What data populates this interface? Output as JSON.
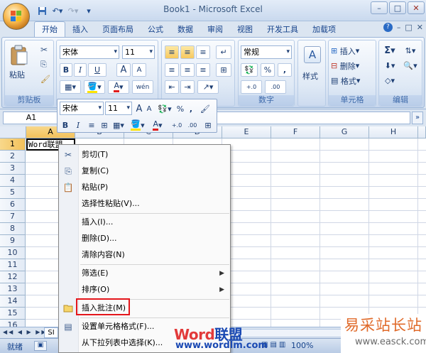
{
  "window": {
    "title": "Book1 - Microsoft Excel"
  },
  "tabs": [
    "开始",
    "插入",
    "页面布局",
    "公式",
    "数据",
    "审阅",
    "视图",
    "开发工具",
    "加载项"
  ],
  "ribbon": {
    "clipboard": {
      "paste": "粘贴",
      "label": "剪贴板"
    },
    "font": {
      "name": "宋体",
      "size": "11",
      "bold": "B",
      "italic": "I",
      "underline": "U",
      "grow": "A",
      "shrink": "A"
    },
    "number": {
      "format": "常规",
      "percent": "%",
      "comma": ",",
      "label": "数字"
    },
    "styles": {
      "label": "样式"
    },
    "cells": {
      "insert": "插入",
      "delete": "删除",
      "format": "格式",
      "label": "单元格"
    },
    "editing": {
      "sigma": "Σ",
      "label": "编辑"
    }
  },
  "formula_bar": {
    "namebox": "A1",
    "value": ""
  },
  "grid": {
    "columns": [
      "A",
      "B",
      "C",
      "D",
      "E",
      "F",
      "G",
      "H"
    ],
    "rows": [
      "1",
      "2",
      "3",
      "4",
      "5",
      "6",
      "7",
      "8",
      "9",
      "10",
      "11",
      "12",
      "13",
      "14",
      "15",
      "16"
    ],
    "A1": "Word联盟"
  },
  "mini_toolbar": {
    "font": "宋体",
    "size": "11",
    "bold": "B",
    "italic": "I",
    "percent": "%",
    "comma": ","
  },
  "context_menu": {
    "items": [
      "剪切(T)",
      "复制(C)",
      "粘贴(P)",
      "选择性粘贴(V)...",
      "插入(I)...",
      "删除(D)...",
      "清除内容(N)",
      "筛选(E)",
      "排序(O)",
      "插入批注(M)",
      "设置单元格格式(F)...",
      "从下拉列表中选择(K)..."
    ]
  },
  "sheet_tab": "SI",
  "status": {
    "ready": "就绪",
    "zoom": "100%"
  },
  "watermark": {
    "brand_red": "Word",
    "brand_blue": "联盟",
    "url": "www.wordlm.com",
    "site": "易采站长站",
    "site_url": "www.easck.com"
  },
  "colors": {
    "accent": "#15428b",
    "highlight": "#e4161b",
    "ribbon": "#dbe6f4"
  }
}
